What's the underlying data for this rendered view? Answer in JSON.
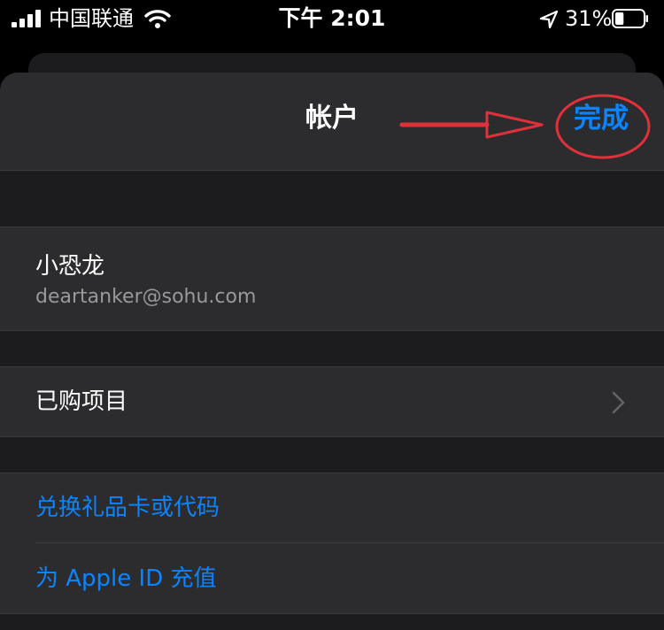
{
  "status_bar": {
    "carrier": "中国联通",
    "time": "下午 2:01",
    "battery_percent": "31%",
    "battery_level": 0.31,
    "icons": [
      "signal-icon",
      "wifi-icon",
      "location-arrow-icon",
      "battery-icon"
    ]
  },
  "nav": {
    "title": "帐户",
    "done_label": "完成"
  },
  "account": {
    "name": "小恐龙",
    "email": "deartanker@sohu.com"
  },
  "purchased": {
    "label": "已购项目"
  },
  "links": {
    "redeem_label": "兑换礼品卡或代码",
    "topup_label": "为 Apple ID 充值"
  },
  "colors": {
    "accent": "#0a84ff",
    "annotation": "#e0313b",
    "background": "#000000",
    "sheet": "#1c1c1e",
    "cell": "#2c2c2e"
  }
}
